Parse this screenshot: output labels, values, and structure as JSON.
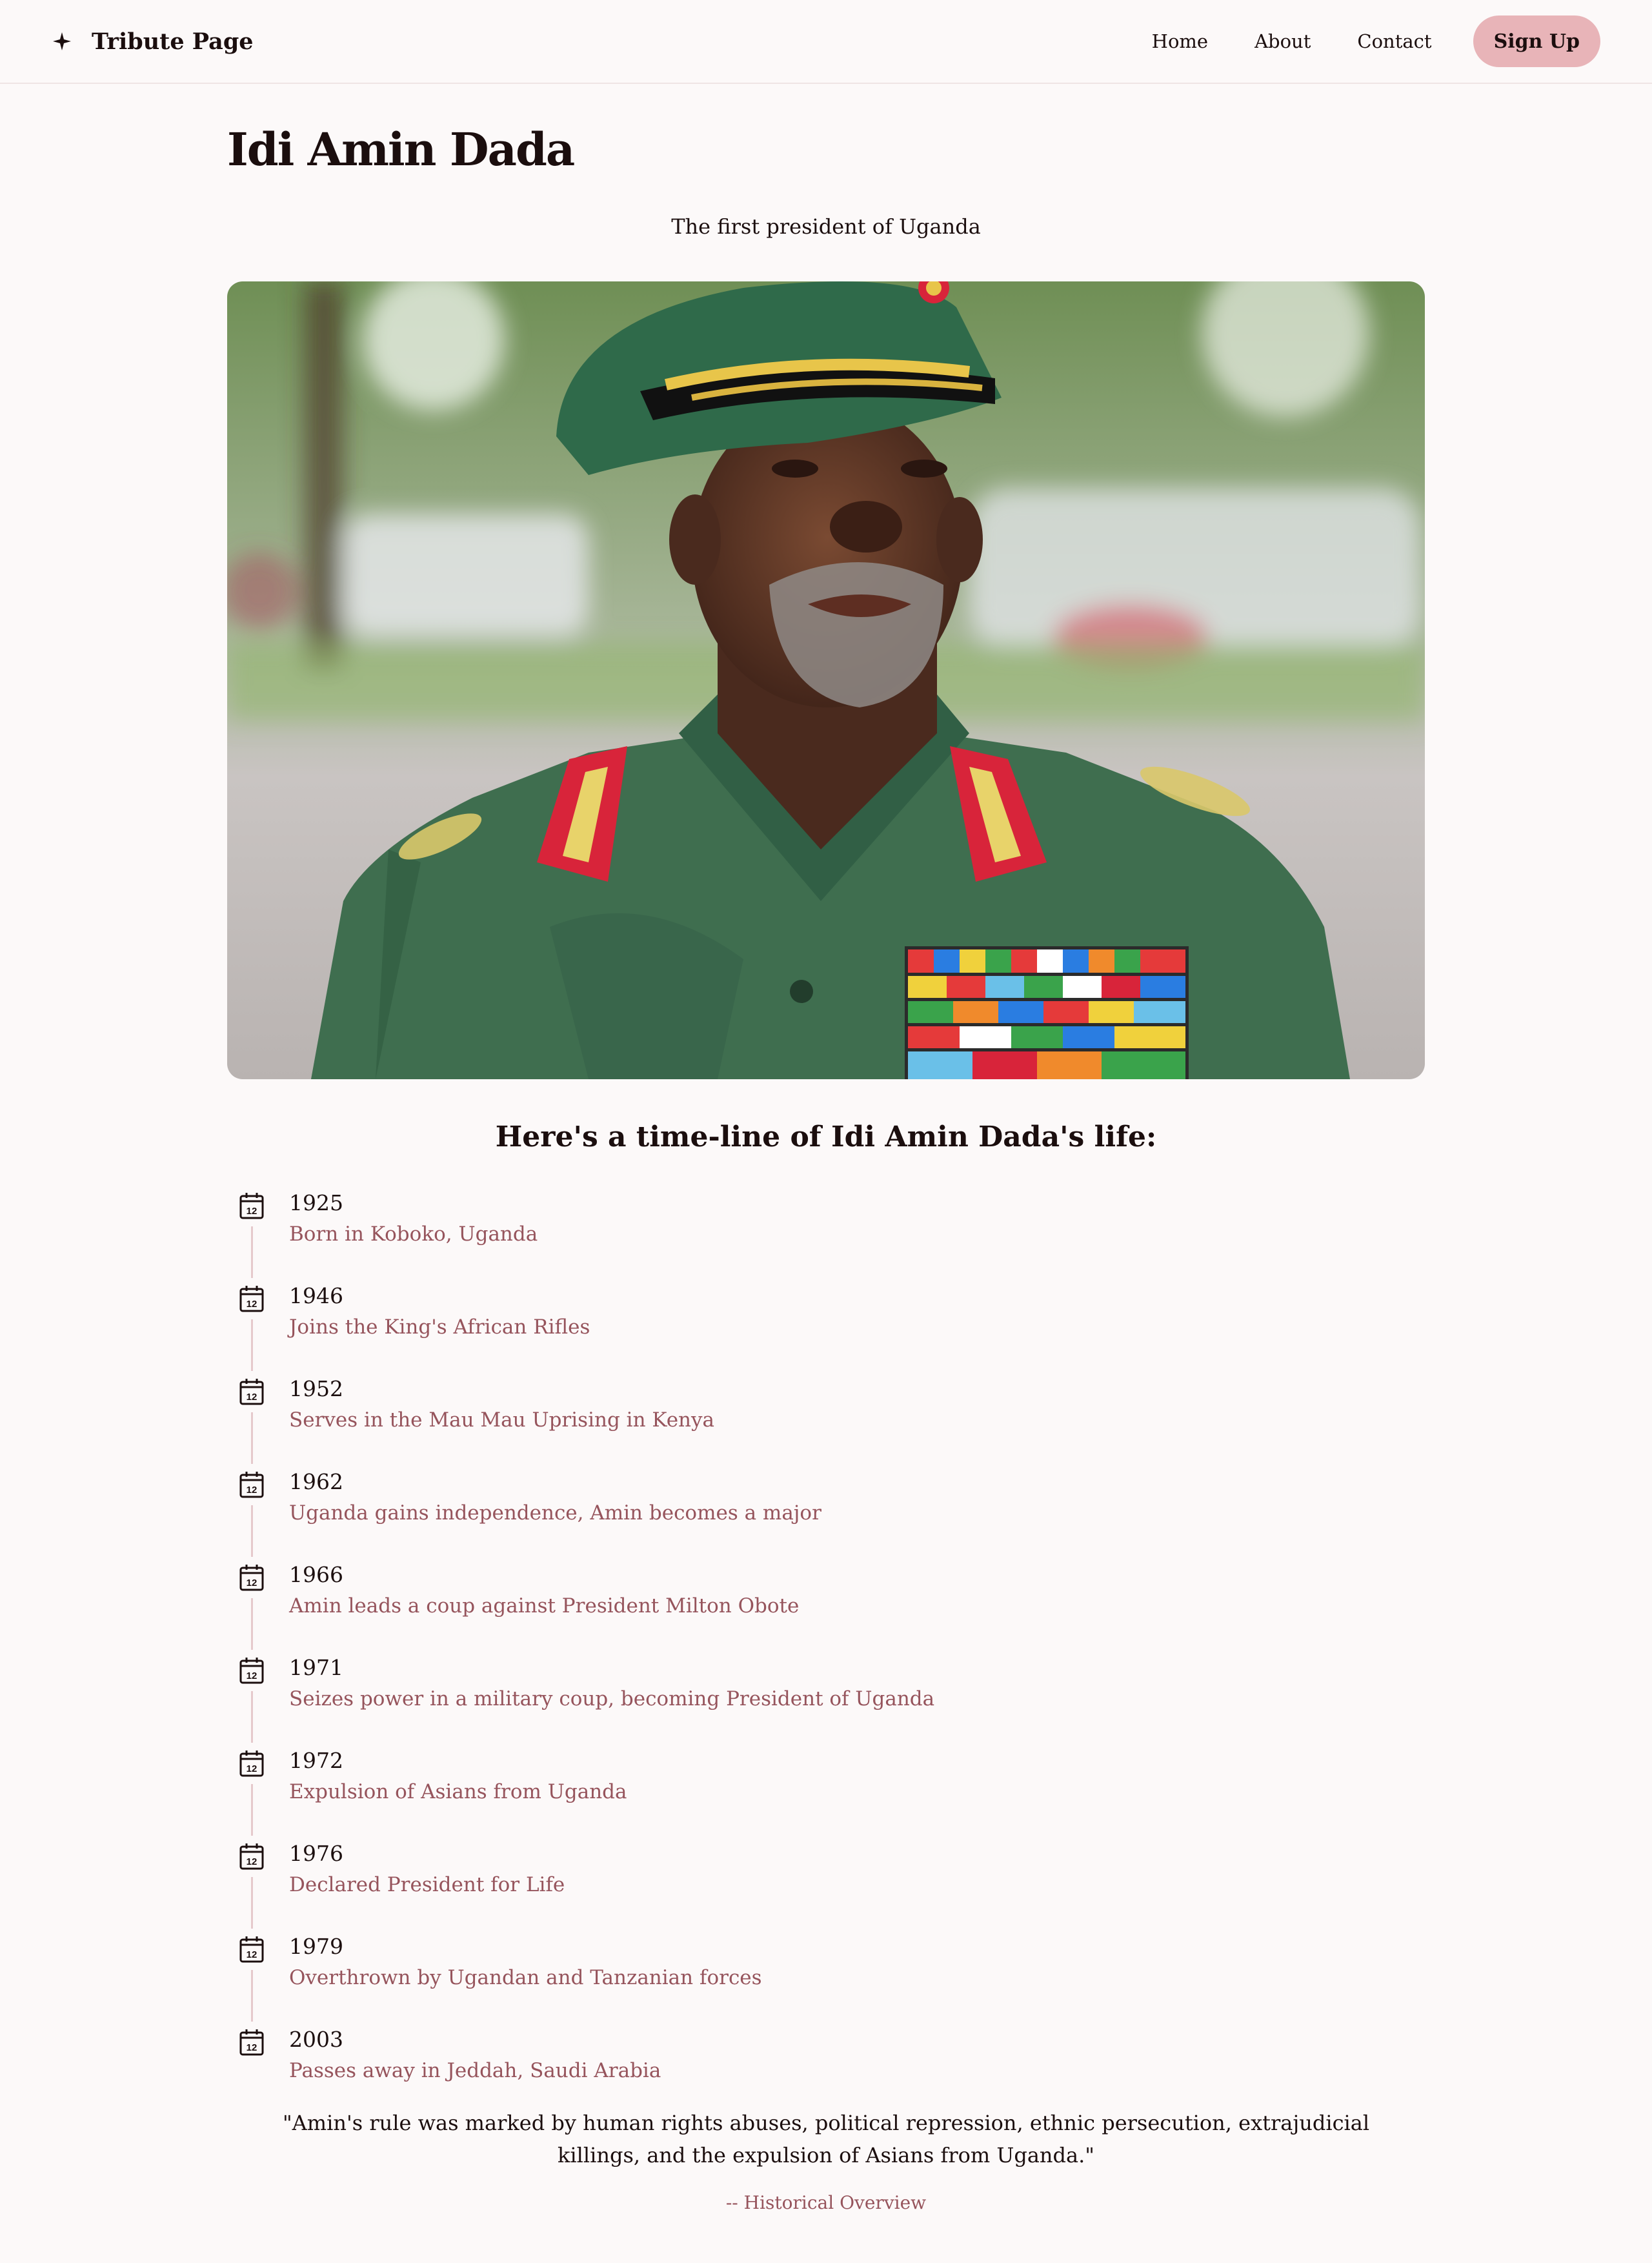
{
  "header": {
    "brand_icon": "sparkle-icon",
    "brand_title": "Tribute Page",
    "nav": [
      "Home",
      "About",
      "Contact"
    ],
    "signup_label": "Sign Up"
  },
  "main": {
    "title": "Idi Amin Dada",
    "subtitle": "The first president of Uganda",
    "timeline_heading": "Here's a time-line of Idi Amin Dada's life:",
    "timeline": [
      {
        "year": "1925",
        "text": "Born in Koboko, Uganda"
      },
      {
        "year": "1946",
        "text": "Joins the King's African Rifles"
      },
      {
        "year": "1952",
        "text": "Serves in the Mau Mau Uprising in Kenya"
      },
      {
        "year": "1962",
        "text": "Uganda gains independence, Amin becomes a major"
      },
      {
        "year": "1966",
        "text": "Amin leads a coup against President Milton Obote"
      },
      {
        "year": "1971",
        "text": "Seizes power in a military coup, becoming President of Uganda"
      },
      {
        "year": "1972",
        "text": "Expulsion of Asians from Uganda"
      },
      {
        "year": "1976",
        "text": "Declared President for Life"
      },
      {
        "year": "1979",
        "text": "Overthrown by Ugandan and Tanzanian forces"
      },
      {
        "year": "2003",
        "text": "Passes away in Jeddah, Saudi Arabia"
      }
    ],
    "timeline_icon": "calendar-icon",
    "calendar_day": "12",
    "quote": "\"Amin's rule was marked by human rights abuses, political repression, ethnic persecution, extrajudicial killings, and the expulsion of Asians from Uganda.\"",
    "attribution": "-- Historical Overview"
  },
  "colors": {
    "background": "#fcf9f9",
    "accent": "#e8b4b8",
    "muted_text": "#96545c",
    "timeline_line": "#e6c9cc"
  }
}
